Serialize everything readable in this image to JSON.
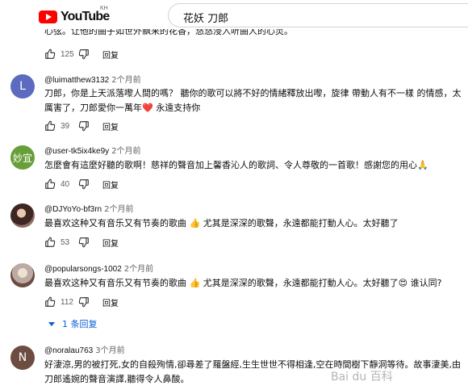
{
  "header": {
    "logo_text": "YouTube",
    "logo_country": "KH",
    "search_query": "花妖 刀郎"
  },
  "partial_comment": {
    "text": "心弦。让他的曲子如世外飘来的花香，悠悠浸入听曲人的心灵。",
    "likes": "125",
    "reply_label": "回复"
  },
  "comments": [
    {
      "avatar_letter": "L",
      "avatar_color": "#5c6bc0",
      "author": "@luimatthew3132",
      "time": "2个月前",
      "text": "刀郎，你是上天派落嚟人間的嗎？ 聽你的歌可以將不好的情緒釋放出嚟，旋律 帶動人有不一樣 的情感，太厲害了，刀郎愛你一萬年❤️ 永遠支持你",
      "likes": "39",
      "reply_label": "回复"
    },
    {
      "avatar_letter": "妙宜",
      "avatar_color": "#689f38",
      "author": "@user-tk5ix4ke9y",
      "time": "2个月前",
      "text": "怎麼會有這麼好聽的歌啊！慈祥的聲音加上馨香沁人的歌詞、令人尊敬的一首歌！感謝您的用心🙏",
      "likes": "40",
      "reply_label": "回复"
    },
    {
      "avatar_letter": "",
      "avatar_color": "#5d4037",
      "author": "@DJYoYo-bf3rn",
      "time": "2个月前",
      "text": "最喜欢这种又有音乐又有节奏的歌曲 👍 尤其是深深的歌聲，永遠都能打動人心。太好聽了",
      "likes": "53",
      "reply_label": "回复"
    },
    {
      "avatar_letter": "",
      "avatar_color": "#8d6e63",
      "author": "@popularsongs-1002",
      "time": "2个月前",
      "text": "最喜欢这种又有音乐又有节奏的歌曲 👍 尤其是深深的歌聲，永遠都能打動人心。太好聽了😍 谁认同?",
      "likes": "112",
      "reply_label": "回复"
    },
    {
      "avatar_letter": "N",
      "avatar_color": "#6d4c41",
      "author": "@noralau763",
      "time": "3个月前",
      "text": "好淒涼,男的被打死,女的自殺殉情,卻尋差了羅盤經,生生世世不得相逢,空在時間樹下靜洞等待。故事淒美,由刀郎遙婉的聲音演譯,聽得令人鼻酸。",
      "likes": "",
      "reply_label": ""
    }
  ],
  "replies_toggle": "1 条回复",
  "watermark": "Bai du 百科"
}
